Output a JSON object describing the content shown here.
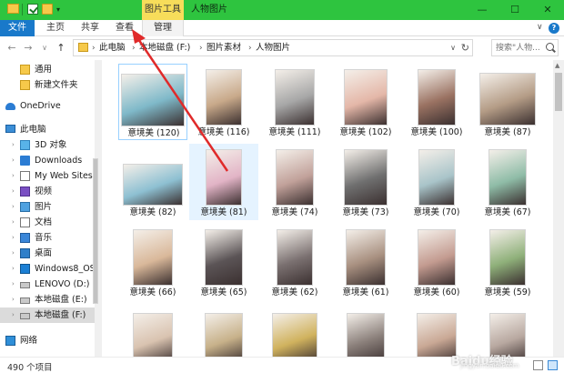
{
  "titlebar": {
    "picture_tools_label": "图片工具",
    "window_title": "人物图片",
    "minimize": "—",
    "maximize": "☐",
    "close": "✕",
    "qa_dropdown": "▾"
  },
  "ribbon": {
    "tabs": [
      {
        "label": "文件"
      },
      {
        "label": "主页"
      },
      {
        "label": "共享"
      },
      {
        "label": "查看"
      },
      {
        "label": "管理"
      }
    ],
    "collapse": "∨"
  },
  "address": {
    "crumbs": [
      "此电脑",
      "本地磁盘 (F:)",
      "图片素材",
      "人物图片"
    ],
    "search_placeholder": "搜索\"人物..."
  },
  "nav": {
    "back": "←",
    "forward": "→",
    "recent": "∨",
    "up": "↑"
  },
  "sidebar": {
    "items": [
      {
        "label": "通用",
        "icon": "folder-icon"
      },
      {
        "label": "新建文件夹",
        "icon": "folder-icon"
      },
      {
        "label": "OneDrive",
        "icon": "cloud-icon"
      },
      {
        "label": "此电脑",
        "icon": "computer-icon"
      },
      {
        "label": "3D 对象",
        "icon": "3d-objects-icon"
      },
      {
        "label": "Downloads",
        "icon": "download-icon"
      },
      {
        "label": "My Web Sites o",
        "icon": "document-icon"
      },
      {
        "label": "视频",
        "icon": "video-icon"
      },
      {
        "label": "图片",
        "icon": "picture-icon"
      },
      {
        "label": "文档",
        "icon": "document-icon"
      },
      {
        "label": "音乐",
        "icon": "music-icon"
      },
      {
        "label": "桌面",
        "icon": "desktop-icon"
      },
      {
        "label": "Windows8_OS",
        "icon": "os-drive-icon"
      },
      {
        "label": "LENOVO (D:)",
        "icon": "drive-icon"
      },
      {
        "label": "本地磁盘 (E:)",
        "icon": "drive-icon"
      },
      {
        "label": "本地磁盘 (F:)",
        "icon": "drive-icon"
      },
      {
        "label": "网络",
        "icon": "network-icon"
      }
    ]
  },
  "files": [
    {
      "label": "意境美 (120)",
      "color": "#7fb9c9"
    },
    {
      "label": "意境美 (116)",
      "color": "#c8a98a"
    },
    {
      "label": "意境美 (111)",
      "color": "#a7a7a7"
    },
    {
      "label": "意境美 (102)",
      "color": "#e4b7a8"
    },
    {
      "label": "意境美 (100)",
      "color": "#9a7262"
    },
    {
      "label": "意境美 (87)",
      "color": "#b49c86"
    },
    {
      "label": "意境美 (82)",
      "color": "#8ec0d2"
    },
    {
      "label": "意境美 (81)",
      "color": "#e2b4c6"
    },
    {
      "label": "意境美 (74)",
      "color": "#c1a19a"
    },
    {
      "label": "意境美 (73)",
      "color": "#6f6f6f"
    },
    {
      "label": "意境美 (70)",
      "color": "#a9c4c9"
    },
    {
      "label": "意境美 (67)",
      "color": "#8fbca7"
    },
    {
      "label": "意境美 (66)",
      "color": "#d9b89a"
    },
    {
      "label": "意境美 (65)",
      "color": "#5b5456"
    },
    {
      "label": "意境美 (62)",
      "color": "#7a7070"
    },
    {
      "label": "意境美 (61)",
      "color": "#a89080"
    },
    {
      "label": "意境美 (60)",
      "color": "#c39b90"
    },
    {
      "label": "意境美 (59)",
      "color": "#8fb07a"
    },
    {
      "label": "",
      "color": "#d9c3b0"
    },
    {
      "label": "",
      "color": "#c7b18a"
    },
    {
      "label": "",
      "color": "#d0b25e"
    },
    {
      "label": "",
      "color": "#8a7f7a"
    },
    {
      "label": "",
      "color": "#c9a895"
    },
    {
      "label": "",
      "color": "#b8a8a0"
    }
  ],
  "status": {
    "item_count": "490 个项目"
  },
  "watermark": {
    "text": "Baidu经验",
    "sub": "jingyan.baidu.com"
  }
}
